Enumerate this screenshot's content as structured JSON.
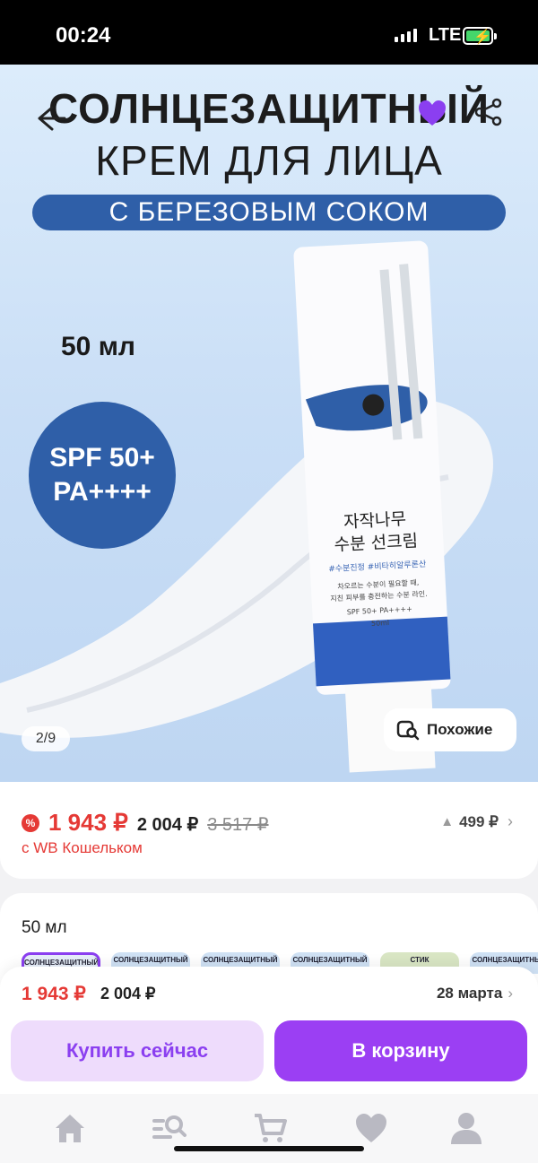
{
  "status_bar": {
    "time": "00:24",
    "network": "LTE"
  },
  "hero": {
    "title_line1": "СОЛНЦЕЗАЩИТНЫЙ",
    "title_line2": "КРЕМ ДЛЯ ЛИЦА",
    "subtitle": "С БЕРЕЗОВЫМ СОКОМ",
    "volume": "50 мл",
    "spf_line1": "SPF 50+",
    "spf_line2": "PA++++",
    "tube_text": {
      "name_line1": "자작나무",
      "name_line2": "수분 선크림",
      "tags": "#수분진정 #비타히알루론산",
      "desc_line1": "차오르는 수분이 필요할 때,",
      "desc_line2": "지친 피부를 충전하는 수분 라인.",
      "spf": "SPF 50+ PA++++",
      "volume": "50ml"
    },
    "image_counter": "2/9",
    "similar_label": "Похожие",
    "icons": {
      "back": "back-arrow-icon",
      "favorite": "heart-icon",
      "share": "share-icon"
    },
    "colors": {
      "accent_blue": "#2f5fa8",
      "favorite": "#8b3ff0"
    }
  },
  "price": {
    "discount_badge": "%",
    "current": "1 943 ₽",
    "regular": "2 004 ₽",
    "old": "3 517 ₽",
    "wallet_note": "с WB Кошельком",
    "price_history": "499 ₽",
    "colors": {
      "price_red": "#e53935"
    }
  },
  "variants": {
    "label": "50 мл",
    "items": [
      "СОЛНЦЕЗАЩИТНЫЙ",
      "СОЛНЦЕЗАЩИТНЫЙ",
      "СОЛНЦЕЗАЩИТНЫЙ",
      "СОЛНЦЕЗАЩИТНЫЙ",
      "СТИК",
      "СОЛНЦЕЗАЩИТНЫЙ"
    ]
  },
  "buy_bar": {
    "price_current": "1 943 ₽",
    "price_regular": "2 004 ₽",
    "delivery_date": "28 марта",
    "buy_now_label": "Купить сейчас",
    "add_to_cart_label": "В корзину",
    "colors": {
      "primary": "#9b3ff3",
      "secondary_bg": "#eedcfc"
    }
  },
  "nav": {
    "items": [
      "home-icon",
      "catalog-search-icon",
      "cart-icon",
      "favorites-icon",
      "profile-icon"
    ]
  }
}
